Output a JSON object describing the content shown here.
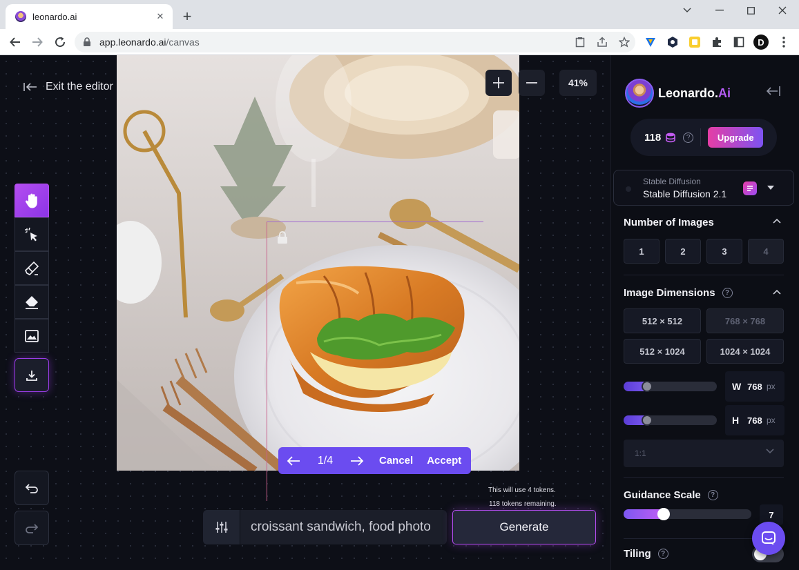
{
  "browser": {
    "tab_title": "leonardo.ai",
    "url_host": "app.leonardo.ai",
    "url_path": "/canvas",
    "profile_initial": "D"
  },
  "editor": {
    "exit_label": "Exit the editor",
    "zoom_level": "41%",
    "pager": {
      "count": "1/4",
      "cancel_label": "Cancel",
      "accept_label": "Accept"
    },
    "token_note_line1": "This will use 4 tokens.",
    "token_note_line2": "118 tokens remaining.",
    "prompt_text": "croissant sandwich, food photo",
    "generate_label": "Generate",
    "tools": [
      "hand-icon",
      "select-icon",
      "paint-brush-icon",
      "eraser-icon",
      "image-icon",
      "download-icon"
    ]
  },
  "sidebar": {
    "brand_name": "Leonardo.",
    "brand_suffix": "Ai",
    "token_count": "118",
    "upgrade_label": "Upgrade",
    "model_family": "Stable Diffusion",
    "model_name": "Stable Diffusion 2.1",
    "number_of_images": {
      "title": "Number of Images",
      "options": [
        "1",
        "2",
        "3",
        "4"
      ]
    },
    "image_dimensions": {
      "title": "Image Dimensions",
      "options": [
        "512 × 512",
        "768 × 768",
        "512 × 1024",
        "1024 × 1024"
      ],
      "width_label": "W",
      "width_value": "768",
      "height_label": "H",
      "height_value": "768",
      "unit": "px",
      "aspect_ratio": "1:1"
    },
    "guidance_scale": {
      "title": "Guidance Scale",
      "value": "7"
    },
    "tiling": {
      "title": "Tiling",
      "enabled": false
    }
  },
  "colors": {
    "accent": "#6b4cf0",
    "brand_pink": "#e53ea5",
    "brand_purple": "#b44df0",
    "background": "#0b0d14"
  }
}
